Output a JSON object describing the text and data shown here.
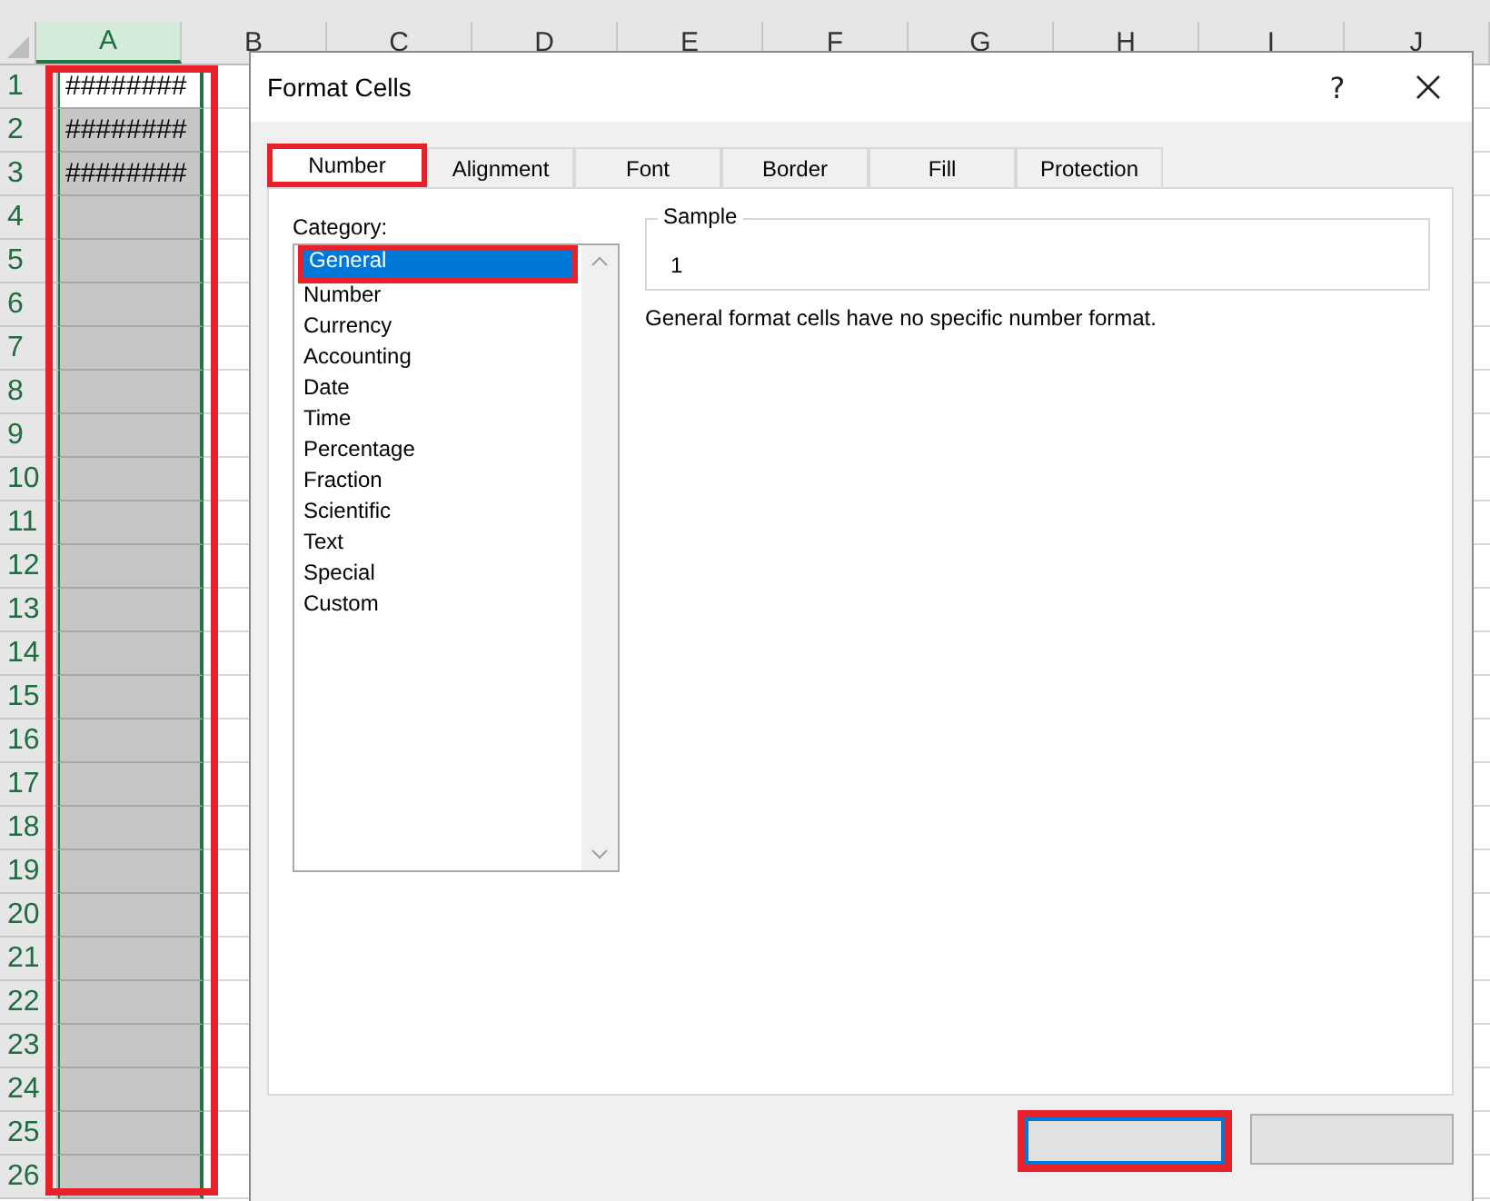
{
  "sheet": {
    "columns": [
      {
        "label": "A",
        "selected": true,
        "highlighted": true
      },
      {
        "label": "B",
        "selected": false,
        "highlighted": false
      },
      {
        "label": "C",
        "selected": false,
        "highlighted": false
      },
      {
        "label": "D",
        "selected": false,
        "highlighted": false
      },
      {
        "label": "E",
        "selected": false,
        "highlighted": false
      },
      {
        "label": "F",
        "selected": false,
        "highlighted": false
      },
      {
        "label": "G",
        "selected": false,
        "highlighted": false
      },
      {
        "label": "H",
        "selected": false,
        "highlighted": false
      },
      {
        "label": "I",
        "selected": false,
        "highlighted": false
      },
      {
        "label": "J",
        "selected": false,
        "highlighted": false
      }
    ],
    "rows": [
      {
        "number": "1",
        "cell_a": "########"
      },
      {
        "number": "2",
        "cell_a": "########"
      },
      {
        "number": "3",
        "cell_a": "########"
      },
      {
        "number": "4"
      },
      {
        "number": "5"
      },
      {
        "number": "6"
      },
      {
        "number": "7"
      },
      {
        "number": "8"
      },
      {
        "number": "9"
      },
      {
        "number": "10"
      },
      {
        "number": "11"
      },
      {
        "number": "12"
      },
      {
        "number": "13"
      },
      {
        "number": "14"
      },
      {
        "number": "15"
      },
      {
        "number": "16"
      },
      {
        "number": "17"
      },
      {
        "number": "18"
      },
      {
        "number": "19"
      },
      {
        "number": "20"
      },
      {
        "number": "21"
      },
      {
        "number": "22"
      },
      {
        "number": "23"
      },
      {
        "number": "24"
      },
      {
        "number": "25"
      },
      {
        "number": "26"
      }
    ]
  },
  "dialog": {
    "title": "Format Cells",
    "help": "?",
    "tabs": [
      {
        "label": "Number",
        "selected": true,
        "highlighted": true
      },
      {
        "label": "Alignment",
        "selected": false,
        "highlighted": false
      },
      {
        "label": "Font",
        "selected": false,
        "highlighted": false
      },
      {
        "label": "Border",
        "selected": false,
        "highlighted": false
      },
      {
        "label": "Fill",
        "selected": false,
        "highlighted": false
      },
      {
        "label": "Protection",
        "selected": false,
        "highlighted": false
      }
    ],
    "category_label": "Category:",
    "categories": [
      {
        "label": "General",
        "selected": true,
        "highlighted": true
      },
      {
        "label": "Number",
        "selected": false,
        "highlighted": false
      },
      {
        "label": "Currency",
        "selected": false,
        "highlighted": false
      },
      {
        "label": "Accounting",
        "selected": false,
        "highlighted": false
      },
      {
        "label": "Date",
        "selected": false,
        "highlighted": false
      },
      {
        "label": "Time",
        "selected": false,
        "highlighted": false
      },
      {
        "label": "Percentage",
        "selected": false,
        "highlighted": false
      },
      {
        "label": "Fraction",
        "selected": false,
        "highlighted": false
      },
      {
        "label": "Scientific",
        "selected": false,
        "highlighted": false
      },
      {
        "label": "Text",
        "selected": false,
        "highlighted": false
      },
      {
        "label": "Special",
        "selected": false,
        "highlighted": false
      },
      {
        "label": "Custom",
        "selected": false,
        "highlighted": false
      }
    ],
    "sample": {
      "label": "Sample",
      "value": "1"
    },
    "description": "General format cells have no specific number format.",
    "buttons": [
      {
        "kind": "default",
        "highlighted": true
      },
      {
        "kind": "normal",
        "highlighted": false
      }
    ]
  }
}
